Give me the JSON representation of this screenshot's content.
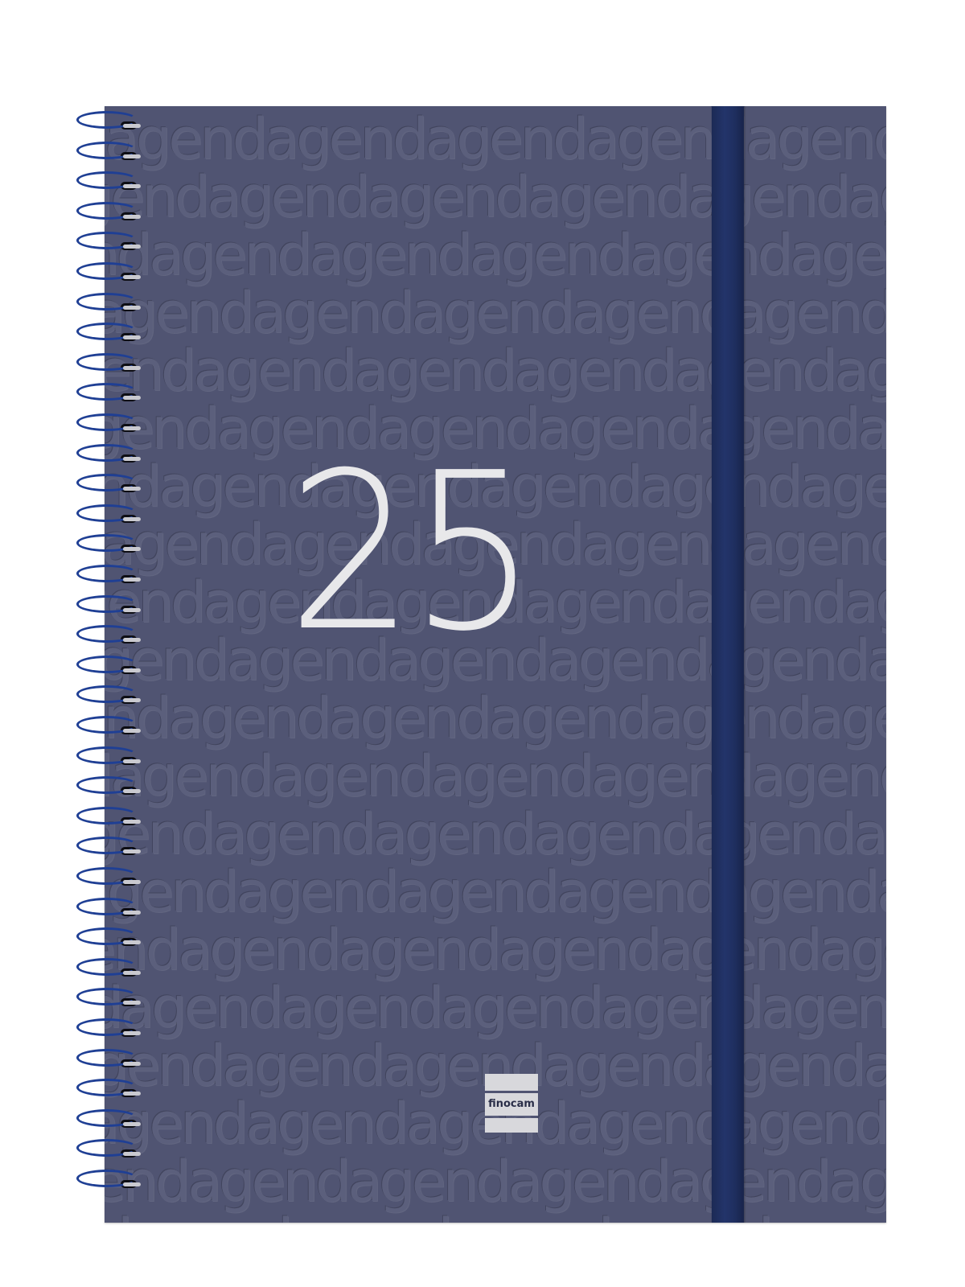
{
  "cover": {
    "color": "#505472",
    "pattern_word": "agend",
    "year": "25",
    "year_color": "#e8e8ea",
    "band_color": "#1f2f60"
  },
  "brand": {
    "logo_text": "finocam"
  },
  "spiral": {
    "color": "#1f3f94",
    "loops": 36
  }
}
